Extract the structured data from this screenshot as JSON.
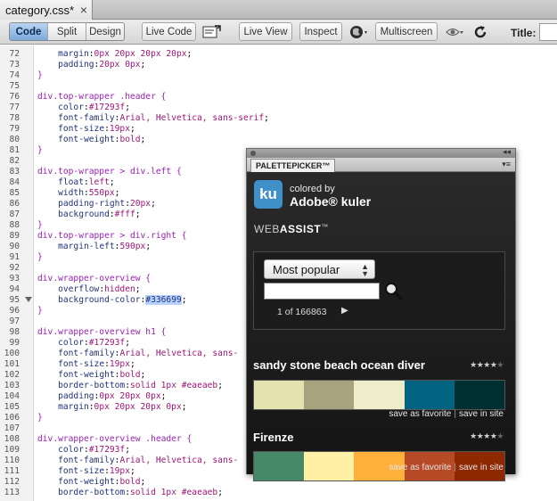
{
  "document_tab": {
    "title": "category.css*",
    "close_icon": "×"
  },
  "toolbar": {
    "view_modes": [
      "Code",
      "Split",
      "Design"
    ],
    "active_view": "Code",
    "live_code": "Live Code",
    "live_view": "Live View",
    "inspect": "Inspect",
    "multiscreen": "Multiscreen",
    "title_label": "Title:",
    "title_value": ""
  },
  "code_lines": [
    {
      "n": "72",
      "html": "    <span class='prop'>margin</span>:<span class='val'>0px 20px 20px 20px</span>;"
    },
    {
      "n": "73",
      "html": "    <span class='prop'>padding</span>:<span class='val'>20px 0px</span>;"
    },
    {
      "n": "74",
      "html": "<span class='brace'>}</span>"
    },
    {
      "n": "75",
      "html": ""
    },
    {
      "n": "76",
      "html": "<span class='sel'>div.top-wrapper .header {</span>"
    },
    {
      "n": "77",
      "html": "    <span class='prop'>color</span>:<span class='val'>#17293f</span>;"
    },
    {
      "n": "78",
      "html": "    <span class='prop'>font-family</span>:<span class='val'>Arial, Helvetica, sans-serif</span>;"
    },
    {
      "n": "79",
      "html": "    <span class='prop'>font-size</span>:<span class='val'>19px</span>;"
    },
    {
      "n": "80",
      "html": "    <span class='prop'>font-weight</span>:<span class='val'>bold</span>;"
    },
    {
      "n": "81",
      "html": "<span class='brace'>}</span>"
    },
    {
      "n": "82",
      "html": ""
    },
    {
      "n": "83",
      "html": "<span class='sel'>div.top-wrapper &gt; div.left {</span>"
    },
    {
      "n": "84",
      "html": "    <span class='prop'>float</span>:<span class='val'>left</span>;"
    },
    {
      "n": "85",
      "html": "    <span class='prop'>width</span>:<span class='val'>550px</span>;"
    },
    {
      "n": "86",
      "html": "    <span class='prop'>padding-right</span>:<span class='val'>20px</span>;"
    },
    {
      "n": "87",
      "html": "    <span class='prop'>background</span>:<span class='val'>#fff</span>;"
    },
    {
      "n": "88",
      "html": "<span class='brace'>}</span>"
    },
    {
      "n": "89",
      "html": "<span class='sel'>div.top-wrapper &gt; div.right {</span>"
    },
    {
      "n": "90",
      "html": "    <span class='prop'>margin-left</span>:<span class='val'>590px</span>;"
    },
    {
      "n": "91",
      "html": "<span class='brace'>}</span>"
    },
    {
      "n": "92",
      "html": ""
    },
    {
      "n": "93",
      "html": "<span class='sel'>div.wrapper-overview {</span>"
    },
    {
      "n": "94",
      "html": "    <span class='prop'>overflow</span>:<span class='val'>hidden</span>;"
    },
    {
      "n": "95",
      "html": "    <span class='prop'>background-color</span>:<span class='hl'>#336699</span>;",
      "fold": true
    },
    {
      "n": "96",
      "html": "<span class='brace'>}</span>"
    },
    {
      "n": "97",
      "html": ""
    },
    {
      "n": "98",
      "html": "<span class='sel'>div.wrapper-overview h1 {</span>"
    },
    {
      "n": "99",
      "html": "    <span class='prop'>color</span>:<span class='val'>#17293f</span>;"
    },
    {
      "n": "100",
      "html": "    <span class='prop'>font-family</span>:<span class='val'>Arial, Helvetica, sans-</span>"
    },
    {
      "n": "101",
      "html": "    <span class='prop'>font-size</span>:<span class='val'>19px</span>;"
    },
    {
      "n": "102",
      "html": "    <span class='prop'>font-weight</span>:<span class='val'>bold</span>;"
    },
    {
      "n": "103",
      "html": "    <span class='prop'>border-bottom</span>:<span class='val'>solid 1px #eaeaeb</span>;"
    },
    {
      "n": "104",
      "html": "    <span class='prop'>padding</span>:<span class='val'>0px 20px 0px</span>;"
    },
    {
      "n": "105",
      "html": "    <span class='prop'>margin</span>:<span class='val'>0px 20px 20px 0px</span>;"
    },
    {
      "n": "106",
      "html": "<span class='brace'>}</span>"
    },
    {
      "n": "107",
      "html": ""
    },
    {
      "n": "108",
      "html": "<span class='sel'>div.wrapper-overview .header {</span>"
    },
    {
      "n": "109",
      "html": "    <span class='prop'>color</span>:<span class='val'>#17293f</span>;"
    },
    {
      "n": "110",
      "html": "    <span class='prop'>font-family</span>:<span class='val'>Arial, Helvetica, sans-</span>"
    },
    {
      "n": "111",
      "html": "    <span class='prop'>font-size</span>:<span class='val'>19px</span>;"
    },
    {
      "n": "112",
      "html": "    <span class='prop'>font-weight</span>:<span class='val'>bold</span>;"
    },
    {
      "n": "113",
      "html": "    <span class='prop'>border-bottom</span>:<span class='val'>solid 1px #eaeaeb</span>;"
    }
  ],
  "palette_panel": {
    "tab_label": "PALETTEPICKER™",
    "menu_icon": "▾≡",
    "collapse_icon": "◂◂",
    "logo_text": "ku",
    "colored_by": "colored by",
    "brand": "Adobe® kuler",
    "webassist_light": "WEB",
    "webassist_bold": "ASSIST",
    "webassist_tm": "™",
    "sort_value": "Most popular",
    "search_placeholder": "",
    "pager": "1 of 166863",
    "pager_next": "▶",
    "themes": [
      {
        "title": "sandy stone beach ocean diver",
        "rating": 4,
        "colors": [
          "#e6e2af",
          "#a7a37e",
          "#efecca",
          "#046380",
          "#002f2f"
        ],
        "save_favorite": "save as favorite",
        "save_site": "save in site"
      },
      {
        "title": "Firenze",
        "rating": 4,
        "colors": [
          "#468966",
          "#fff0a5",
          "#ffb03b",
          "#b64926",
          "#8e2800"
        ],
        "save_favorite": "save as favorite",
        "save_site": "save in site"
      }
    ]
  }
}
